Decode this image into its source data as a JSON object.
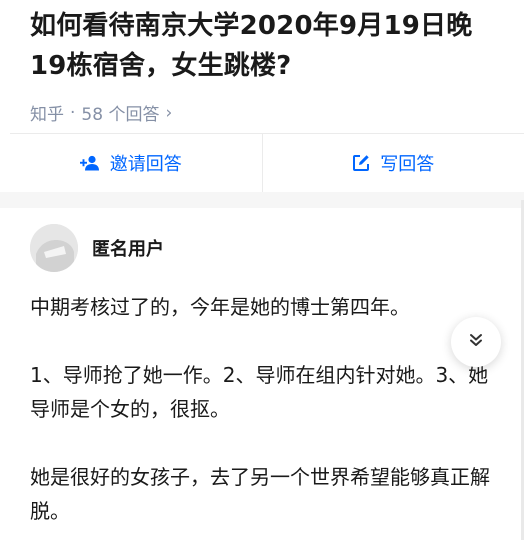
{
  "question": {
    "title": "如何看待南京大学2020年9月19日晚19栋宿舍，女生跳楼?",
    "source": "知乎",
    "separator": "·",
    "answer_count_text": "58 个回答",
    "chevron": "›"
  },
  "actions": {
    "invite_label": "邀请回答",
    "write_label": "写回答",
    "accent_color": "#0066ff"
  },
  "answer": {
    "author_name": "匿名用户",
    "paragraphs": [
      "中期考核过了的，今年是她的博士第四年。",
      "1、导师抢了她一作。2、导师在组内针对她。3、她导师是个女的，很抠。",
      "她是很好的女孩子，去了另一个世界希望能够真正解脱。"
    ]
  },
  "icons": {
    "invite": "add-person-icon",
    "write": "edit-icon",
    "expand": "double-chevron-down-icon"
  }
}
